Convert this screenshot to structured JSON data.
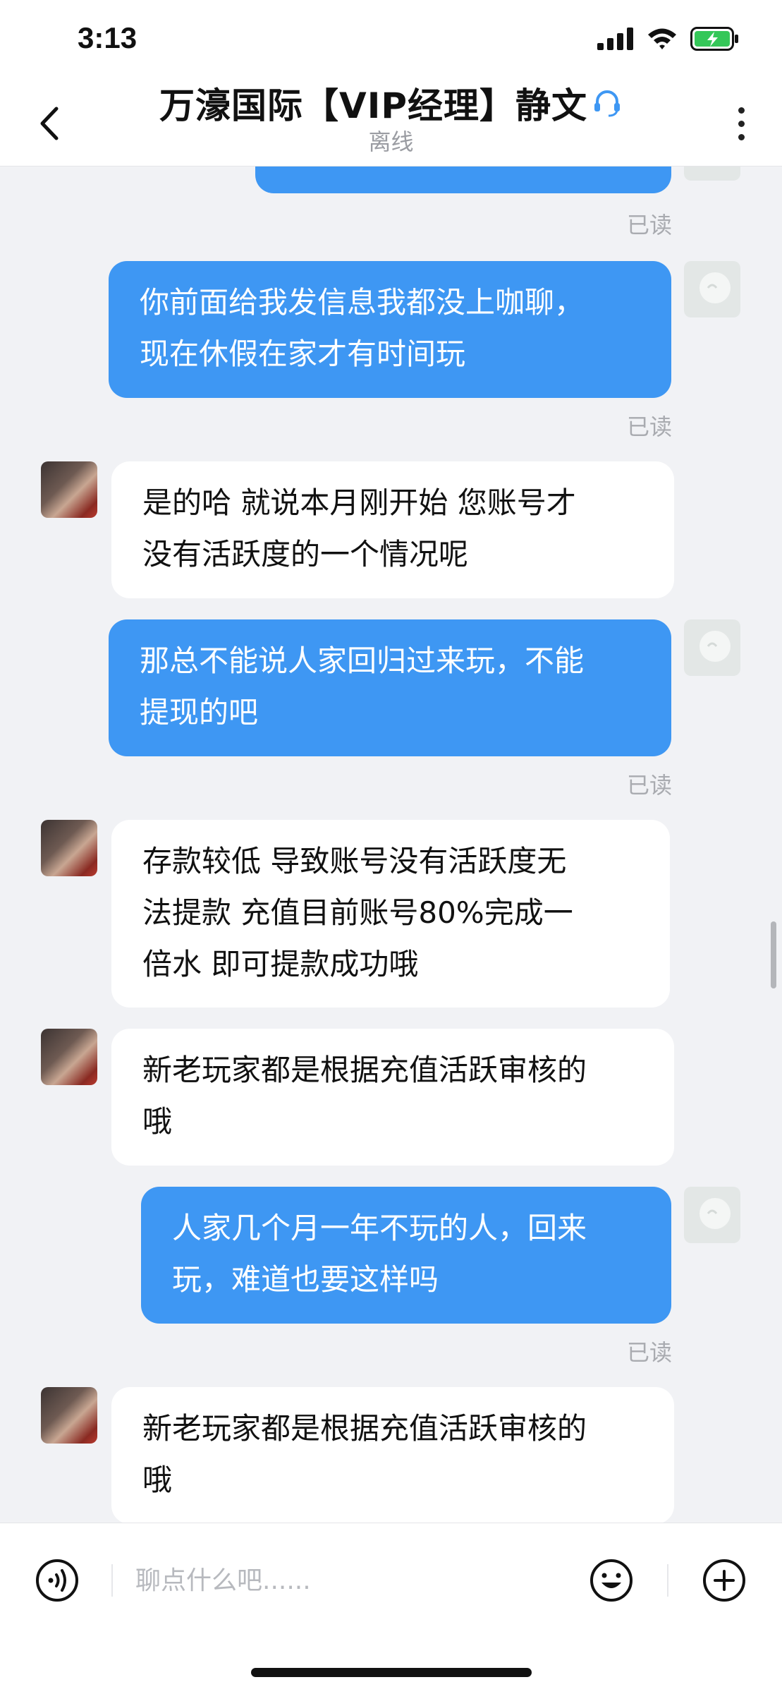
{
  "status_bar": {
    "time": "3:13"
  },
  "header": {
    "title": "万濠国际【VIP经理】静文",
    "subtitle": "离线"
  },
  "messages": [
    {
      "side": "me",
      "text": "",
      "read": "已读"
    },
    {
      "side": "me",
      "text": "你前面给我发信息我都没上咖聊，\n现在休假在家才有时间玩",
      "read": "已读"
    },
    {
      "side": "them",
      "text": "是的哈   就说本月刚开始  您账号才\n没有活跃度的一个情况呢"
    },
    {
      "side": "me",
      "text": "那总不能说人家回归过来玩，不能\n提现的吧",
      "read": "已读"
    },
    {
      "side": "them",
      "text": "存款较低   导致账号没有活跃度无\n法提款   充值目前账号80%完成一\n倍水  即可提款成功哦"
    },
    {
      "side": "them",
      "text": "新老玩家都是根据充值活跃审核的\n哦"
    },
    {
      "side": "me",
      "text": "人家几个月一年不玩的人，回来\n玩，难道也要这样吗",
      "read": "已读"
    },
    {
      "side": "them",
      "text": "新老玩家都是根据充值活跃审核的\n哦"
    }
  ],
  "input": {
    "placeholder": "聊点什么吧......"
  },
  "colors": {
    "me_bubble": "#3e97f3",
    "them_bubble": "#ffffff",
    "background": "#f1f2f5"
  }
}
